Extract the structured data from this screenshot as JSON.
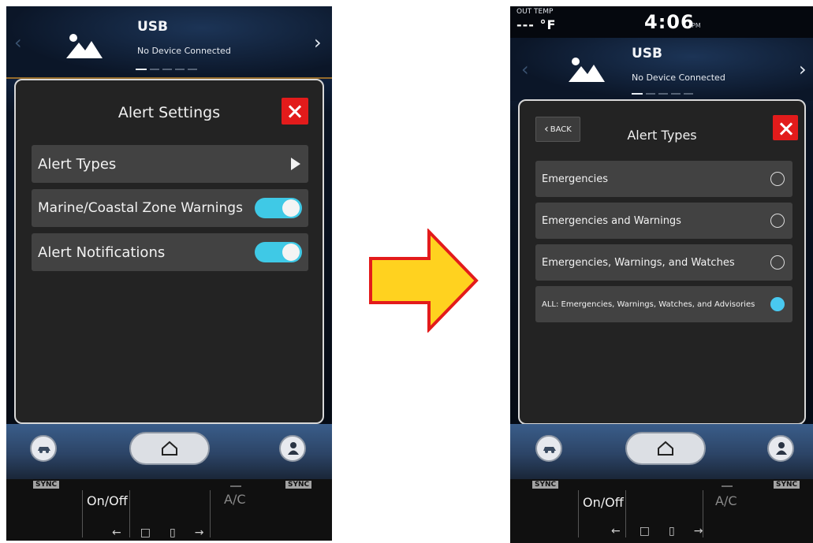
{
  "left": {
    "media": {
      "title": "USB",
      "subtitle": "No Device Connected"
    },
    "dialog": {
      "title": "Alert Settings",
      "rows": [
        {
          "label": "Alert Types",
          "control": "arrow"
        },
        {
          "label": "Marine/Coastal Zone Warnings",
          "control": "toggle",
          "on": true
        },
        {
          "label": "Alert Notifications",
          "control": "toggle",
          "on": true
        }
      ]
    },
    "climate": {
      "sync_left": "SYNC",
      "sync_right": "SYNC",
      "onoff": "On/Off",
      "ac": "A/C"
    }
  },
  "right": {
    "status": {
      "out_temp_label": "OUT TEMP",
      "out_temp_value": "--- °F",
      "time": "4:06",
      "ampm": "PM"
    },
    "media": {
      "title": "USB",
      "subtitle": "No Device Connected"
    },
    "dialog": {
      "title": "Alert Types",
      "back_label": "BACK",
      "options": [
        {
          "label": "Emergencies",
          "selected": false
        },
        {
          "label": "Emergencies and Warnings",
          "selected": false
        },
        {
          "label": "Emergencies, Warnings, and Watches",
          "selected": false
        },
        {
          "label": "ALL: Emergencies, Warnings, Watches, and Advisories",
          "selected": true
        }
      ]
    },
    "climate": {
      "sync_left": "SYNC",
      "sync_right": "SYNC",
      "onoff": "On/Off",
      "ac": "A/C"
    }
  },
  "colors": {
    "toggle_on": "#3fc9e6",
    "radio_selected": "#49c9f0",
    "close_red": "#e21b1b",
    "arrow_fill": "#ffd21f",
    "arrow_stroke": "#e31b1b"
  }
}
